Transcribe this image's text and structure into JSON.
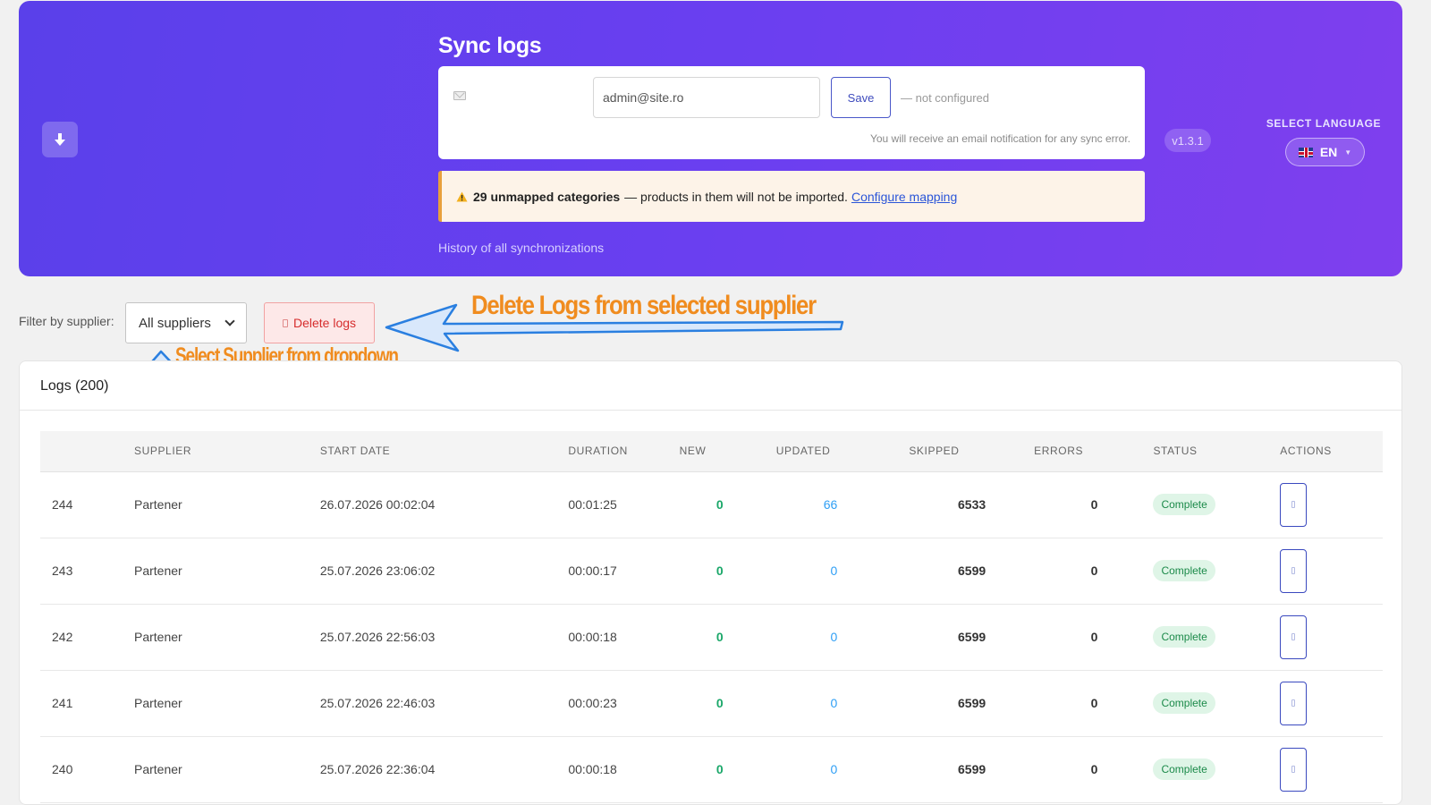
{
  "header": {
    "title": "Sync logs",
    "download_icon": "download-icon",
    "email": {
      "value": "admin@site.ro",
      "placeholder": "",
      "icon": "mail-icon"
    },
    "save_label": "Save",
    "config_status": "— not configured",
    "notify_text": "You will receive an email notification for any sync error.",
    "warning": {
      "icon": "warning-icon",
      "count_text": "29 unmapped categories",
      "message": "— products in them will not be imported.",
      "link": "Configure mapping"
    },
    "history_text": "History of all synchronizations",
    "version": "v1.3.1",
    "language": {
      "label": "SELECT LANGUAGE",
      "value": "EN",
      "flag_icon": "uk-flag-icon"
    }
  },
  "filter": {
    "label": "Filter by supplier:",
    "selected": "All suppliers",
    "delete_label": "Delete logs",
    "delete_icon": "trash-icon"
  },
  "annotations": {
    "delete_hint": "Delete Logs from selected supplier",
    "select_hint": "Select Supplier from dropdown"
  },
  "logs": {
    "title": "Logs (200)",
    "columns": [
      "",
      "SUPPLIER",
      "START DATE",
      "DURATION",
      "NEW",
      "UPDATED",
      "SKIPPED",
      "ERRORS",
      "STATUS",
      "ACTIONS"
    ],
    "rows": [
      {
        "id": "244",
        "supplier": "Partener",
        "start": "26.07.2026 00:02:04",
        "duration": "00:01:25",
        "new": "0",
        "updated": "66",
        "skipped": "6533",
        "errors": "0",
        "status": "Complete"
      },
      {
        "id": "243",
        "supplier": "Partener",
        "start": "25.07.2026 23:06:02",
        "duration": "00:00:17",
        "new": "0",
        "updated": "0",
        "skipped": "6599",
        "errors": "0",
        "status": "Complete"
      },
      {
        "id": "242",
        "supplier": "Partener",
        "start": "25.07.2026 22:56:03",
        "duration": "00:00:18",
        "new": "0",
        "updated": "0",
        "skipped": "6599",
        "errors": "0",
        "status": "Complete"
      },
      {
        "id": "241",
        "supplier": "Partener",
        "start": "25.07.2026 22:46:03",
        "duration": "00:00:23",
        "new": "0",
        "updated": "0",
        "skipped": "6599",
        "errors": "0",
        "status": "Complete"
      },
      {
        "id": "240",
        "supplier": "Partener",
        "start": "25.07.2026 22:36:04",
        "duration": "00:00:18",
        "new": "0",
        "updated": "0",
        "skipped": "6599",
        "errors": "0",
        "status": "Complete"
      }
    ]
  },
  "colors": {
    "hero_start": "#5a40ea",
    "hero_end": "#7f3fee",
    "success": "#1aa769",
    "link": "#2f9ff5",
    "danger": "#d62d2d",
    "annotation": "#f08c1f",
    "arrow": "#2a7fe0"
  }
}
